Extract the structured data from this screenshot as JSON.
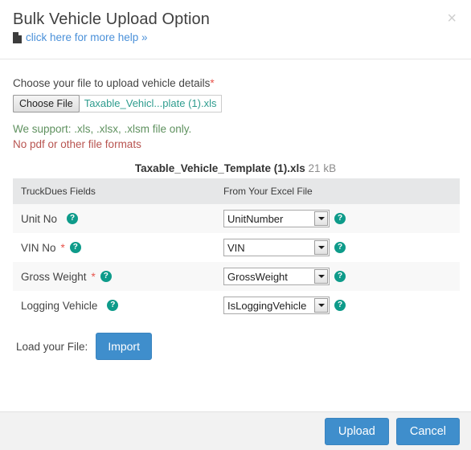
{
  "dialog": {
    "title": "Bulk Vehicle Upload Option",
    "help_link": "click here for more help »",
    "close_label": "×",
    "doc_icon": "document-icon"
  },
  "upload": {
    "label": "Choose your file to upload vehicle details",
    "required_marker": "*",
    "choose_file_button": "Choose File",
    "selected_file_display": "Taxable_Vehicl...plate (1).xls",
    "support_note": "We support: .xls, .xlsx, .xlsm file only.",
    "support_warning": "No pdf or other file formats"
  },
  "file_summary": {
    "name": "Taxable_Vehicle_Template (1).xls",
    "size": "21 kB"
  },
  "mapping_table": {
    "headers": [
      "TruckDues Fields",
      "From Your Excel File"
    ],
    "rows": [
      {
        "field": "Unit No",
        "required": false,
        "required_marker": "",
        "selected": "UnitNumber",
        "help_icon": "question-icon"
      },
      {
        "field": "VIN No",
        "required": true,
        "required_marker": "*",
        "selected": "VIN",
        "help_icon": "question-icon"
      },
      {
        "field": "Gross Weight",
        "required": true,
        "required_marker": "*",
        "selected": "GrossWeight",
        "help_icon": "question-icon"
      },
      {
        "field": "Logging Vehicle",
        "required": false,
        "required_marker": "",
        "selected": "IsLoggingVehicle",
        "help_icon": "question-icon"
      }
    ],
    "help_badge_glyph": "?"
  },
  "load_section": {
    "label": "Load your File:",
    "import_button": "Import"
  },
  "footer": {
    "upload_button": "Upload",
    "cancel_button": "Cancel"
  },
  "colors": {
    "accent_blue": "#3f8ecc",
    "teal": "#0e9b8a",
    "link_blue": "#4a90d9",
    "success_green": "#5f915f",
    "warning_red": "#b85450",
    "required_star": "#e8554d"
  }
}
